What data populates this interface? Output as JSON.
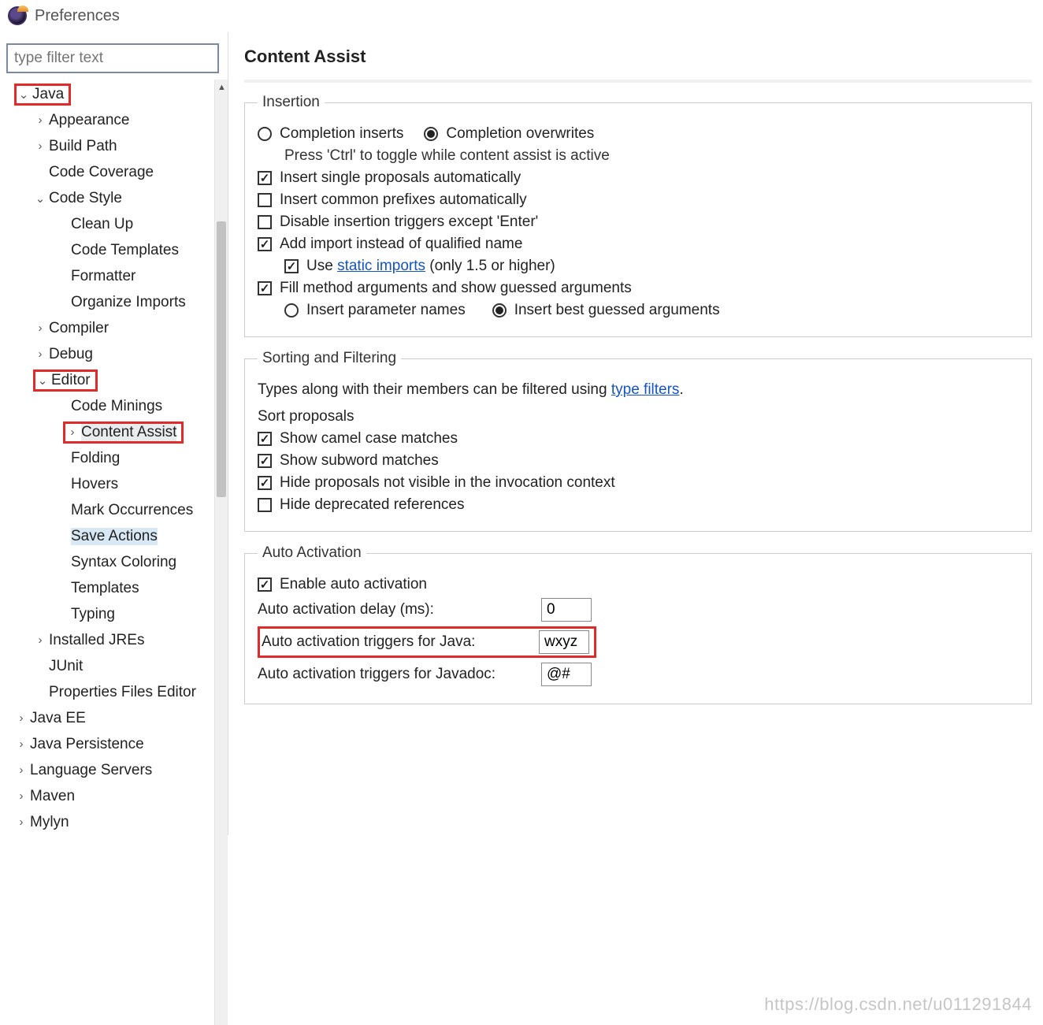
{
  "window": {
    "title": "Preferences"
  },
  "sidebar": {
    "filter_placeholder": "type filter text",
    "items": [
      {
        "label": "Java",
        "depth": 0,
        "expander": "v",
        "red": true
      },
      {
        "label": "Appearance",
        "depth": 1,
        "expander": ">"
      },
      {
        "label": "Build Path",
        "depth": 1,
        "expander": ">"
      },
      {
        "label": "Code Coverage",
        "depth": 1,
        "expander": ""
      },
      {
        "label": "Code Style",
        "depth": 1,
        "expander": "v"
      },
      {
        "label": "Clean Up",
        "depth": 2,
        "expander": ""
      },
      {
        "label": "Code Templates",
        "depth": 2,
        "expander": ""
      },
      {
        "label": "Formatter",
        "depth": 2,
        "expander": ""
      },
      {
        "label": "Organize Imports",
        "depth": 2,
        "expander": ""
      },
      {
        "label": "Compiler",
        "depth": 1,
        "expander": ">"
      },
      {
        "label": "Debug",
        "depth": 1,
        "expander": ">"
      },
      {
        "label": "Editor",
        "depth": 1,
        "expander": "v",
        "red": true
      },
      {
        "label": "Code Minings",
        "depth": 2,
        "expander": ""
      },
      {
        "label": "Content Assist",
        "depth": 3,
        "expander": ">",
        "red": true,
        "selected": true
      },
      {
        "label": "Folding",
        "depth": 2,
        "expander": ""
      },
      {
        "label": "Hovers",
        "depth": 2,
        "expander": ""
      },
      {
        "label": "Mark Occurrences",
        "depth": 2,
        "expander": ""
      },
      {
        "label": "Save Actions",
        "depth": 2,
        "expander": "",
        "save": true
      },
      {
        "label": "Syntax Coloring",
        "depth": 2,
        "expander": ""
      },
      {
        "label": "Templates",
        "depth": 2,
        "expander": ""
      },
      {
        "label": "Typing",
        "depth": 2,
        "expander": ""
      },
      {
        "label": "Installed JREs",
        "depth": 1,
        "expander": ">"
      },
      {
        "label": "JUnit",
        "depth": 1,
        "expander": ""
      },
      {
        "label": "Properties Files Editor",
        "depth": 1,
        "expander": ""
      },
      {
        "label": "Java EE",
        "depth": 0,
        "expander": ">"
      },
      {
        "label": "Java Persistence",
        "depth": 0,
        "expander": ">"
      },
      {
        "label": "Language Servers",
        "depth": 0,
        "expander": ">"
      },
      {
        "label": "Maven",
        "depth": 0,
        "expander": ">"
      },
      {
        "label": "Mylyn",
        "depth": 0,
        "expander": ">"
      }
    ]
  },
  "page": {
    "title": "Content Assist"
  },
  "insertion": {
    "legend": "Insertion",
    "radio_inserts": "Completion inserts",
    "radio_overwrites": "Completion overwrites",
    "toggle_hint": "Press 'Ctrl' to toggle while content assist is active",
    "cb_single": "Insert single proposals automatically",
    "cb_common": "Insert common prefixes automatically",
    "cb_disable": "Disable insertion triggers except 'Enter'",
    "cb_import": "Add import instead of qualified name",
    "cb_static_prefix": "Use ",
    "cb_static_link": "static imports",
    "cb_static_suffix": " (only 1.5 or higher)",
    "cb_fill": "Fill method arguments and show guessed arguments",
    "radio_param": "Insert parameter names",
    "radio_best": "Insert best guessed arguments"
  },
  "sorting": {
    "legend": "Sorting and Filtering",
    "filter_text_pre": "Types along with their members can be filtered using ",
    "filter_link": "type filters",
    "sort_header": "Sort proposals",
    "cb_camel": "Show camel case matches",
    "cb_subword": "Show subword matches",
    "cb_hide": "Hide proposals not visible in the invocation context",
    "cb_deprecated": "Hide deprecated references"
  },
  "auto": {
    "legend": "Auto Activation",
    "cb_enable": "Enable auto activation",
    "delay_label": "Auto activation delay (ms):",
    "delay_value": "0",
    "java_label": "Auto activation triggers for Java:",
    "java_value": "wxyz",
    "javadoc_label": "Auto activation triggers for Javadoc:",
    "javadoc_value": "@#"
  },
  "watermark": "https://blog.csdn.net/u011291844"
}
